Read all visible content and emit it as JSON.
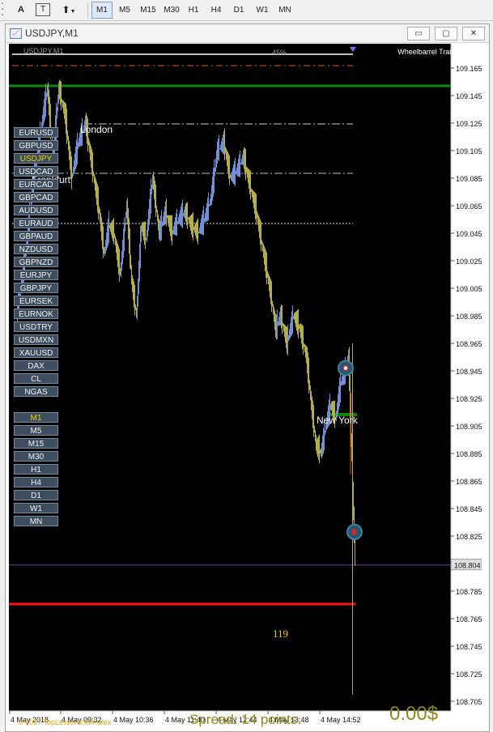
{
  "toolbar": {
    "text_tool_label": "A",
    "text_label_tool_label": "T",
    "timeframes": [
      "M1",
      "M5",
      "M15",
      "M30",
      "H1",
      "H4",
      "D1",
      "W1",
      "MN"
    ],
    "active_timeframe": "M1"
  },
  "window": {
    "title": "USDJPY,M1",
    "minimize_label": "▭",
    "restore_label": "▢",
    "close_label": "✕"
  },
  "chart": {
    "header_symbol": "USDJPY,M1",
    "header_dim_text": "45%",
    "ea_name": "Wheelbarrel Trailing_v1.2",
    "current_price": "108.804",
    "price_axis": [
      "109.165",
      "109.145",
      "109.125",
      "109.105",
      "109.085",
      "109.065",
      "109.045",
      "109.025",
      "109.005",
      "108.985",
      "108.965",
      "108.945",
      "108.925",
      "108.905",
      "108.885",
      "108.865",
      "108.845",
      "108.825",
      "108.805",
      "108.785",
      "108.765",
      "108.745",
      "108.725",
      "108.705"
    ],
    "time_axis": [
      "4 May 2018",
      "4 May 09:32",
      "4 May 10:36",
      "4 May 11:40",
      "4 May 12:44",
      "4 May 13:48",
      "4 May 14:52"
    ],
    "sessions": [
      "London",
      "Frankfurt",
      "New York"
    ],
    "tp_points": "119",
    "copyright": "© 2017 TopLessons.In/Forex",
    "spread_text": "Spread: 14 points.",
    "profit_text": "0.00$",
    "colors": {
      "up_candle": "#6f8fd8",
      "down_candle": "#b3b040",
      "level_green": "#0a8a0a",
      "level_red": "#ff1010",
      "bid_line": "#6040a0"
    }
  },
  "symbols": [
    "EURUSD",
    "GBPUSD",
    "USDJPY",
    "USDCAD",
    "EURCAD",
    "GBPCAD",
    "AUDUSD",
    "EURAUD",
    "GBPAUD",
    "NZDUSD",
    "GBPNZD",
    "EURJPY",
    "GBPJPY",
    "EURSEK",
    "EURNOK",
    "USDTRY",
    "USDMXN",
    "XAUUSD",
    "DAX",
    "CL",
    "NGAS"
  ],
  "active_symbol": "USDJPY",
  "timeframe_buttons": [
    "M1",
    "M5",
    "M15",
    "M30",
    "H1",
    "H4",
    "D1",
    "W1",
    "MN"
  ],
  "active_timeframe_button": "M1"
}
